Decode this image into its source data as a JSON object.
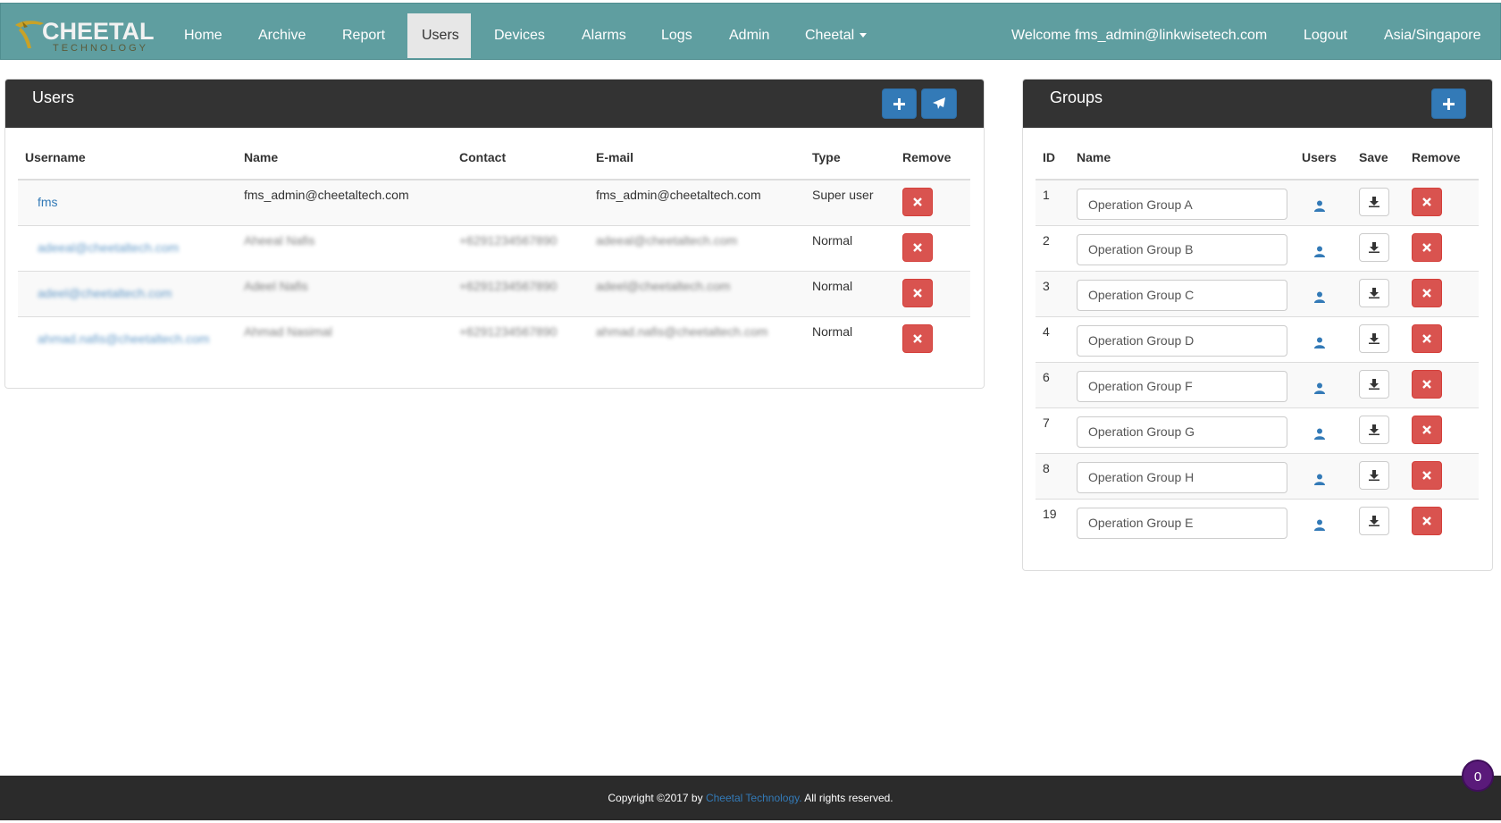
{
  "brand": {
    "logo_main": "CHEETAL",
    "logo_sub": "TECHNOLOGY"
  },
  "nav": {
    "items": [
      {
        "label": "Home"
      },
      {
        "label": "Archive"
      },
      {
        "label": "Report"
      },
      {
        "label": "Users",
        "active": true
      },
      {
        "label": "Devices"
      },
      {
        "label": "Alarms"
      },
      {
        "label": "Logs"
      },
      {
        "label": "Admin"
      },
      {
        "label": "Cheetal"
      }
    ],
    "welcome": "Welcome fms_admin@linkwisetech.com",
    "logout": "Logout",
    "timezone": "Asia/Singapore"
  },
  "users_panel": {
    "title": "Users",
    "add_icon": "plus-icon",
    "send_icon": "paper-plane-icon",
    "columns": [
      "Username",
      "Name",
      "Contact",
      "E-mail",
      "Type",
      "Remove"
    ],
    "rows": [
      {
        "username": "fms",
        "name": "fms_admin@cheetaltech.com",
        "contact": "",
        "email": "fms_admin@cheetaltech.com",
        "type": "Super user",
        "blurred": false
      },
      {
        "username": "adeeal@cheetaltech.com",
        "name": "Aheeal Nafis",
        "contact": "+6291234567890",
        "email": "adeeal@cheetaltech.com",
        "type": "Normal",
        "blurred": true
      },
      {
        "username": "adeel@cheetaltech.com",
        "name": "Adeel Nafis",
        "contact": "+6291234567890",
        "email": "adeel@cheetaltech.com",
        "type": "Normal",
        "blurred": true
      },
      {
        "username": "ahmad.nafis@cheetaltech.com",
        "name": "Ahmad Nasimal",
        "contact": "+6291234567890",
        "email": "ahmad.nafis@cheetaltech.com",
        "type": "Normal",
        "blurred": true
      }
    ]
  },
  "groups_panel": {
    "title": "Groups",
    "columns": [
      "ID",
      "Name",
      "Users",
      "Save",
      "Remove"
    ],
    "rows": [
      {
        "id": "1",
        "name": "Operation Group A"
      },
      {
        "id": "2",
        "name": "Operation Group B"
      },
      {
        "id": "3",
        "name": "Operation Group C"
      },
      {
        "id": "4",
        "name": "Operation Group D"
      },
      {
        "id": "6",
        "name": "Operation Group F"
      },
      {
        "id": "7",
        "name": "Operation Group G"
      },
      {
        "id": "8",
        "name": "Operation Group H"
      },
      {
        "id": "19",
        "name": "Operation Group E"
      }
    ]
  },
  "footer": {
    "prefix": "Copyright ©2017 by ",
    "brand": "Cheetal Technology.",
    "suffix": " All rights reserved."
  },
  "notification_badge": "0",
  "colors": {
    "navbar": "#5f9ea0",
    "panel_heading": "#333333",
    "primary": "#337ab7",
    "danger": "#d9534f",
    "footer": "#2b2b2b",
    "badge": "#5a1a7a"
  }
}
